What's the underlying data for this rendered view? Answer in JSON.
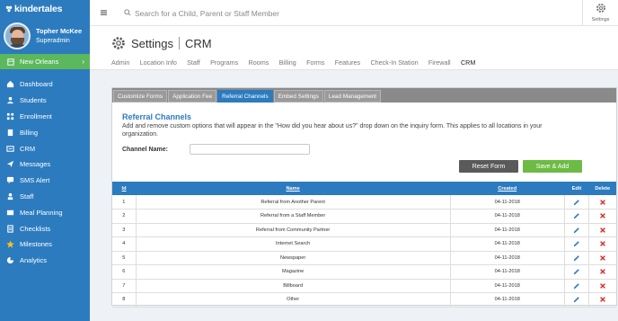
{
  "brand": {
    "name": "kindertales"
  },
  "user": {
    "name": "Topher McKee",
    "role": "Superadmin"
  },
  "location": {
    "name": "New Orleans"
  },
  "sidebar": {
    "items": [
      {
        "label": "Dashboard",
        "icon": "home-icon"
      },
      {
        "label": "Students",
        "icon": "students-icon"
      },
      {
        "label": "Enrollment",
        "icon": "enrollment-icon"
      },
      {
        "label": "Billing",
        "icon": "billing-icon"
      },
      {
        "label": "CRM",
        "icon": "crm-icon"
      },
      {
        "label": "Messages",
        "icon": "paper-plane-icon"
      },
      {
        "label": "SMS Alert",
        "icon": "sms-icon"
      },
      {
        "label": "Staff",
        "icon": "staff-icon"
      },
      {
        "label": "Meal Planning",
        "icon": "meal-icon"
      },
      {
        "label": "Checklists",
        "icon": "checklist-icon"
      },
      {
        "label": "Milestones",
        "icon": "star-icon"
      },
      {
        "label": "Analytics",
        "icon": "analytics-icon"
      }
    ]
  },
  "topbar": {
    "search_placeholder": "Search for a Child, Parent or Staff Member",
    "settings_label": "Settings"
  },
  "page": {
    "title": "Settings",
    "subtitle": "CRM",
    "subnav": [
      "Admin",
      "Location Info",
      "Staff",
      "Programs",
      "Rooms",
      "Billing",
      "Forms",
      "Features",
      "Check-In Station",
      "Firewall",
      "CRM"
    ],
    "subnav_active": "CRM"
  },
  "panel": {
    "tabs": [
      "Customize Forms",
      "Application Fee",
      "Referral Channels",
      "Embed Settings",
      "Lead Management"
    ],
    "active_tab": "Referral Channels",
    "section_title": "Referral Channels",
    "description": "Add and remove custom options that will appear in the \"How did you hear about us?\" drop down on the inquiry form. This applies to all locations in your organization.",
    "channel_label": "Channel Name:",
    "channel_value": "",
    "reset_label": "Reset Form",
    "save_label": "Save & Add"
  },
  "table": {
    "headers": {
      "id": "Id",
      "name": "Name",
      "created": "Created",
      "edit": "Edit",
      "delete": "Delete"
    },
    "rows": [
      {
        "id": "1",
        "name": "Referral from Another Parent",
        "created": "04-11-2018"
      },
      {
        "id": "2",
        "name": "Referral from a Staff Member",
        "created": "04-11-2018"
      },
      {
        "id": "3",
        "name": "Referral from Community Partner",
        "created": "04-11-2018"
      },
      {
        "id": "4",
        "name": "Internet Search",
        "created": "04-11-2018"
      },
      {
        "id": "5",
        "name": "Newspaper",
        "created": "04-11-2018"
      },
      {
        "id": "6",
        "name": "Magazine",
        "created": "04-11-2018"
      },
      {
        "id": "7",
        "name": "Billboard",
        "created": "04-11-2018"
      },
      {
        "id": "8",
        "name": "Other",
        "created": "04-11-2018"
      }
    ]
  },
  "colors": {
    "sidebar": "#2c7bbf",
    "location_bar": "#5cb85c",
    "accent": "#2c7bbf",
    "save_button": "#6cbb45",
    "reset_button": "#5a5a5a",
    "delete_icon": "#d0312d"
  }
}
